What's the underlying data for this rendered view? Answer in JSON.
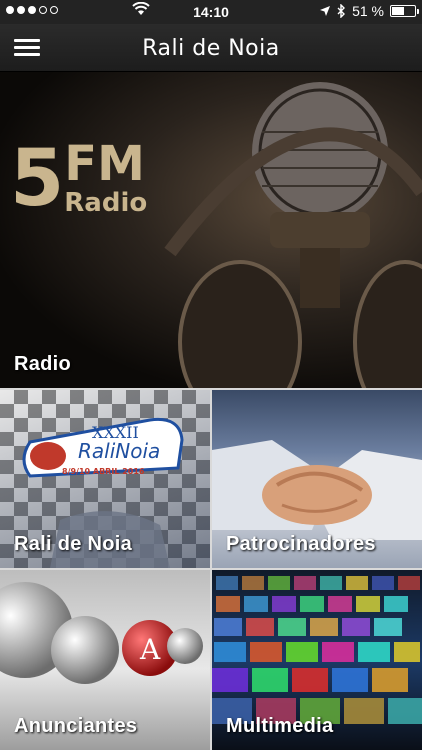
{
  "status_bar": {
    "time": "14:10",
    "battery_text": "51 %",
    "battery_level": 0.51,
    "signal_bars_filled": 3,
    "signal_bars_total": 5
  },
  "nav": {
    "title": "Rali de Noia",
    "menu_icon": "hamburger-menu-icon"
  },
  "tiles": [
    {
      "label": "Radio",
      "logo_text": "5FM Radio",
      "image_desc": "microphone-with-headphones"
    },
    {
      "label": "Rali de Noia",
      "logo_text": "XXXII RaliNoia 8/9/10 ABRIL 2016",
      "image_desc": "checkered-flag"
    },
    {
      "label": "Patrocinadores",
      "image_desc": "handshake"
    },
    {
      "label": "Anunciantes",
      "image_desc": "spheres"
    },
    {
      "label": "Multimedia",
      "image_desc": "video-wall"
    }
  ],
  "colors": {
    "nav_bg": "#232323",
    "text": "#ffffff"
  }
}
